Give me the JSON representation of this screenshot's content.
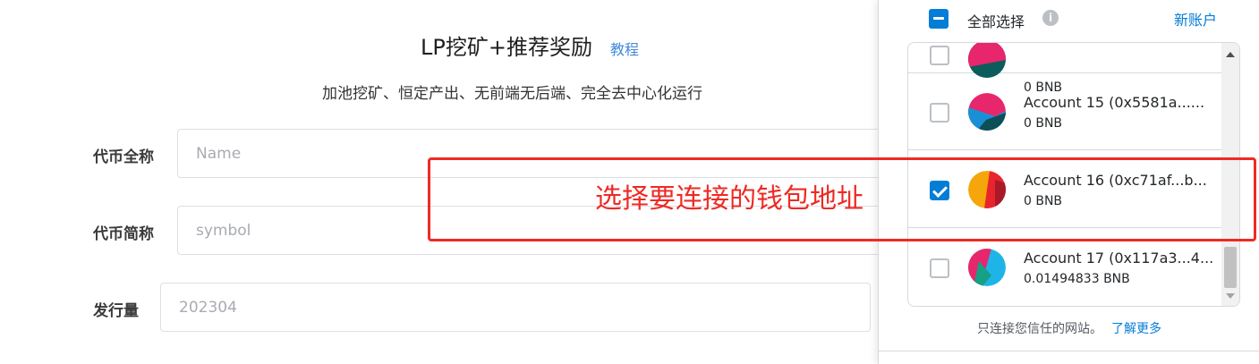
{
  "form": {
    "title": "LP挖矿+推荐奖励",
    "tutorial_link": "教程",
    "subtitle": "加池挖矿、恒定产出、无前端无后端、完全去中心化运行",
    "fields": {
      "full_name_label": "代币全称",
      "full_name_placeholder": "Name",
      "symbol_label": "代币简称",
      "symbol_placeholder": "symbol",
      "supply_label": "发行量",
      "supply_value": "202304"
    }
  },
  "wallet_panel": {
    "select_all_label": "全部选择",
    "new_account_label": "新账户",
    "accounts": [
      {
        "name": "",
        "balance": "0 BNB",
        "checked": false
      },
      {
        "name": "Account 15 (0x5581a......",
        "balance": "0 BNB",
        "checked": false
      },
      {
        "name": "Account 16 (0xc71af...b...",
        "balance": "0 BNB",
        "checked": true
      },
      {
        "name": "Account 17 (0x117a3...4...",
        "balance": "0.01494833 BNB",
        "checked": false
      }
    ],
    "footer_text": "只连接您信任的网站。",
    "learn_more": "了解更多"
  },
  "annotation": {
    "text": "选择要连接的钱包地址",
    "color": "#ee2a24"
  },
  "colors": {
    "accent": "#037dd6",
    "link": "#3f8ad9"
  }
}
